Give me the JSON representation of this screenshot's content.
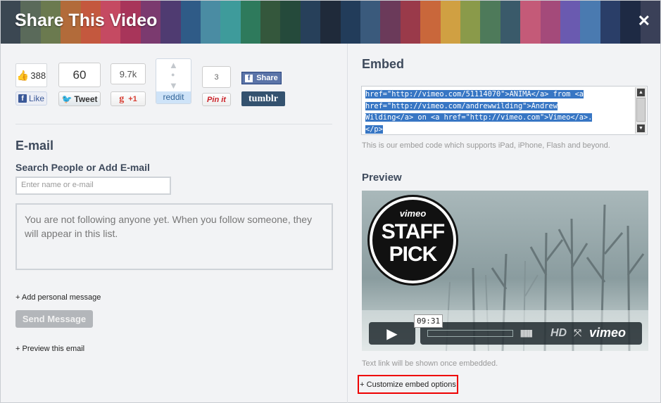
{
  "header": {
    "title": "Share This Video",
    "close_label": "✕",
    "stripe_colors": [
      "#3b4752",
      "#5a6a5a",
      "#6b7a4f",
      "#b26b3a",
      "#c4583e",
      "#c54a62",
      "#a8355a",
      "#7b3a6f",
      "#4f3b71",
      "#2f5b87",
      "#4a8ca3",
      "#3e9b9b",
      "#2e7a5c",
      "#34573c",
      "#254a3b",
      "#27405a",
      "#1f2a3a",
      "#223c5a",
      "#3a5a7c",
      "#6b3a5a",
      "#9a3a4a",
      "#c9673b",
      "#d0a042",
      "#8a9a4a",
      "#4e7a5a",
      "#3a5a6a",
      "#c45a78",
      "#a44a7a",
      "#6a5ab0",
      "#4a7ab0",
      "#2a3e68",
      "#1e2a44",
      "#3a4058"
    ]
  },
  "share": {
    "facebook_count": "388",
    "facebook_like": "Like",
    "twitter_count": "60",
    "twitter_button": "Tweet",
    "gplus_count": "9.7k",
    "gplus_button": "+1",
    "reddit_label": "reddit",
    "pinterest_count": "3",
    "pinterest_button": "Pin it",
    "fb_share": "Share",
    "tumblr": "tumblr"
  },
  "email": {
    "heading": "E-mail",
    "search_label": "Search People or Add E-mail",
    "search_placeholder": "Enter name or e-mail",
    "follow_message": "You are not following anyone yet. When you follow someone, they will appear in this list.",
    "add_message": "+ Add personal message",
    "send_button": "Send Message",
    "preview_email": "+ Preview this email"
  },
  "embed": {
    "heading": "Embed",
    "code_lines": [
      "href=\"http://vimeo.com/51114070\">ANIMA</a> from <a",
      "href=\"http://vimeo.com/andrewwilding\">Andrew",
      "Wilding</a> on <a href=\"http://vimeo.com\">Vimeo</a>.",
      "</p>"
    ],
    "note": "This is our embed code which supports iPad, iPhone, Flash and beyond."
  },
  "preview": {
    "heading": "Preview",
    "badge_top": "vimeo",
    "badge_line1": "STAFF",
    "badge_line2": "PICK",
    "time": "09:31",
    "hd": "HD",
    "logo": "vimeo",
    "text_link_note": "Text link will be shown once embedded.",
    "customize": "+ Customize embed options"
  }
}
